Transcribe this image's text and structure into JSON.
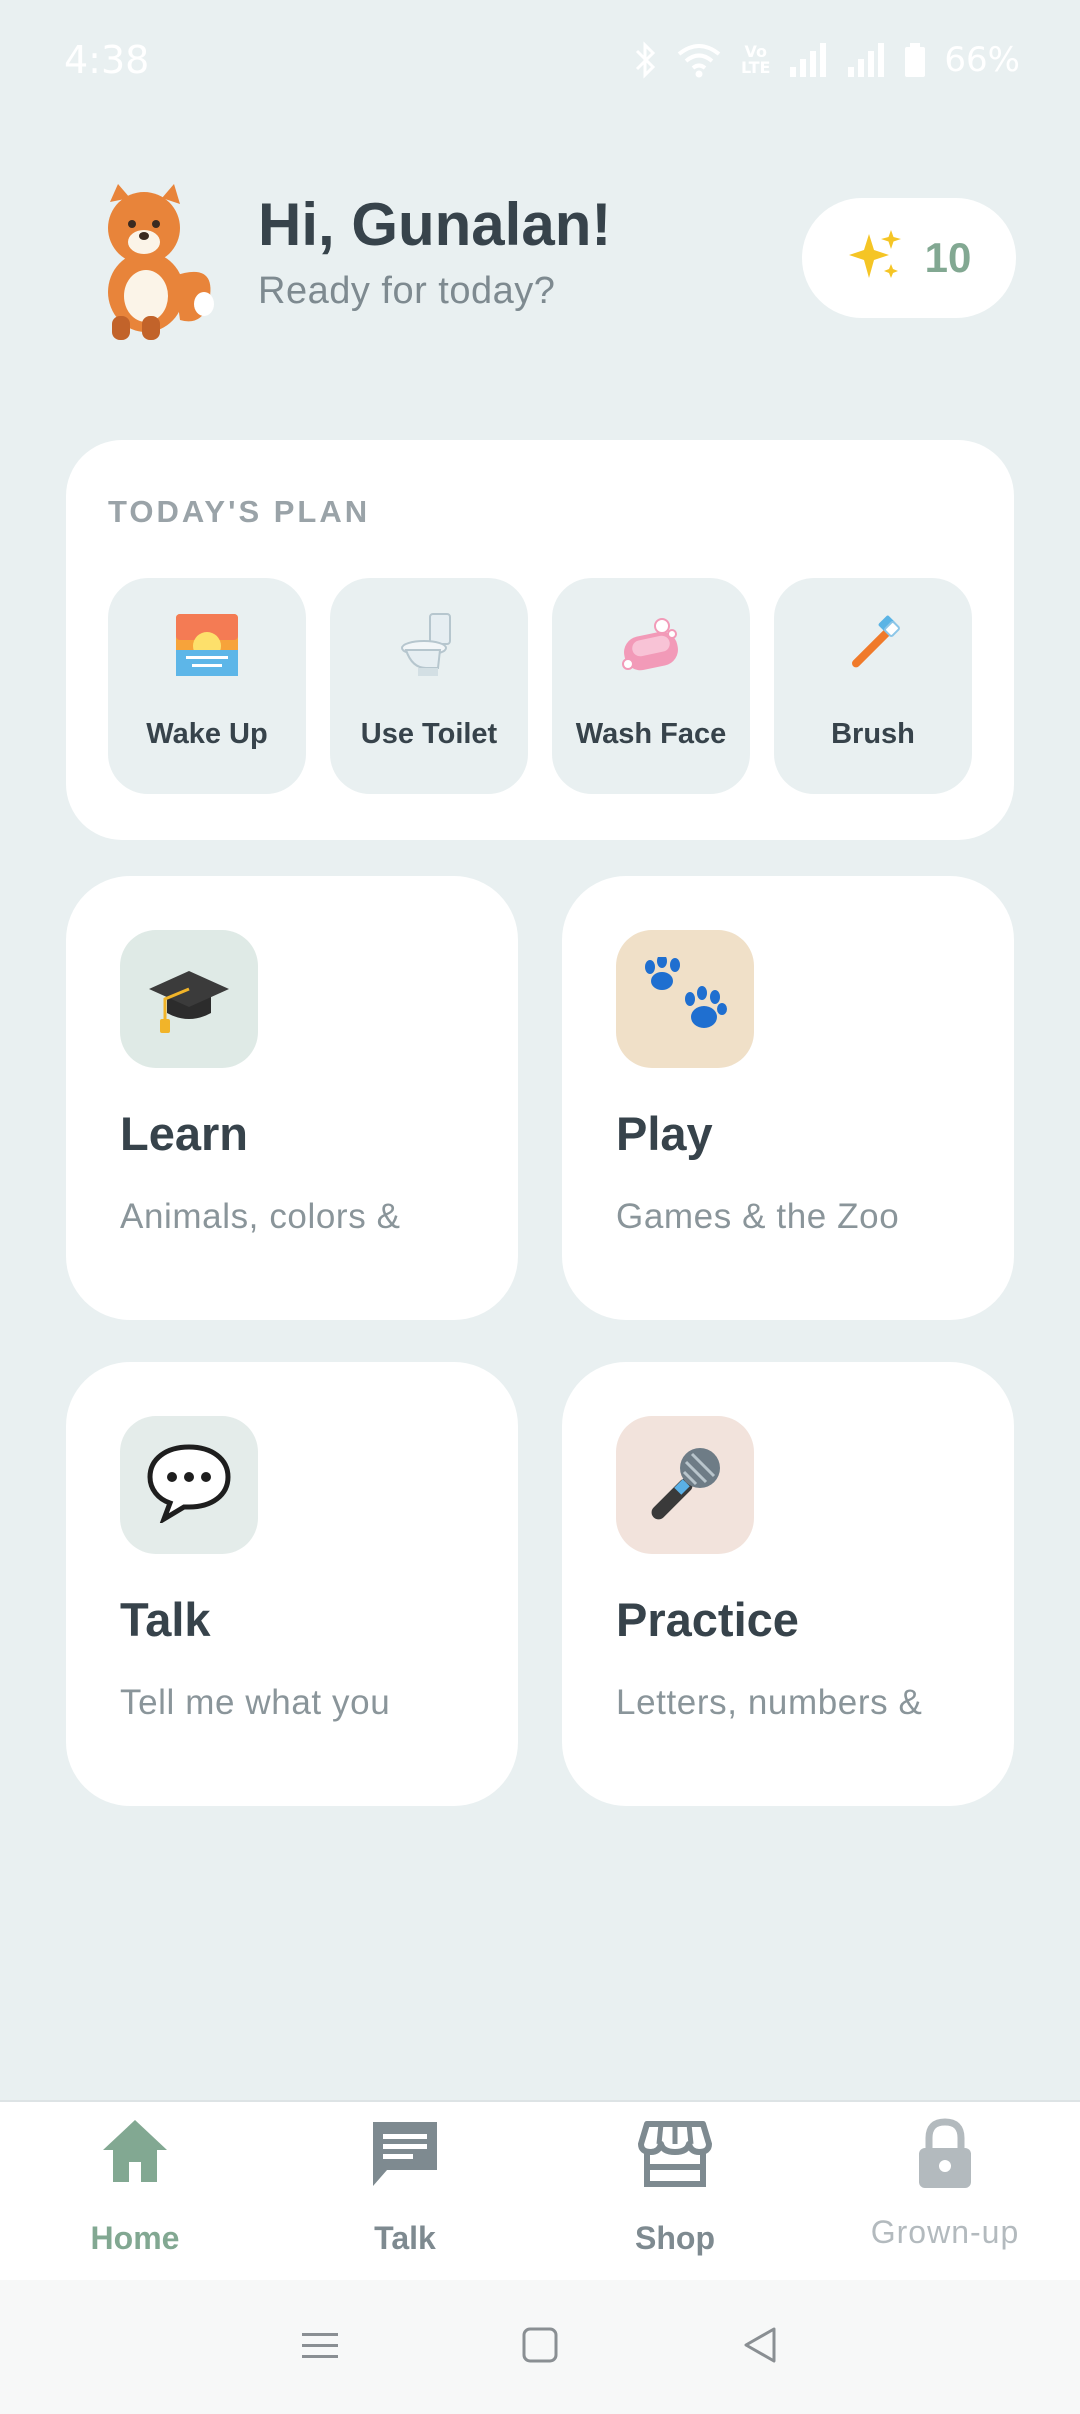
{
  "status_bar": {
    "time": "4:38",
    "battery": "66%",
    "network_badge_top": "Vo",
    "network_badge_bottom": "LTE"
  },
  "header": {
    "title": "Hi, Gunalan!",
    "subtitle": "Ready for today?",
    "stars_count": "10"
  },
  "plan": {
    "title": "TODAY'S PLAN",
    "items": [
      {
        "label": "Wake Up",
        "icon": "sunrise-icon"
      },
      {
        "label": "Use Toilet",
        "icon": "toilet-icon"
      },
      {
        "label": "Wash Face",
        "icon": "soap-icon"
      },
      {
        "label": "Brush",
        "icon": "toothbrush-icon"
      }
    ]
  },
  "cards": [
    {
      "title": "Learn",
      "subtitle": "Animals, colors &",
      "icon": "graduation-cap-icon",
      "icon_bg": "#dfeae6"
    },
    {
      "title": "Play",
      "subtitle": "Games & the Zoo",
      "icon": "paw-prints-icon",
      "icon_bg": "#f0e0c8"
    },
    {
      "title": "Talk",
      "subtitle": "Tell me what you",
      "icon": "speech-bubble-icon",
      "icon_bg": "#e4ecea"
    },
    {
      "title": "Practice",
      "subtitle": "Letters, numbers &",
      "icon": "microphone-icon",
      "icon_bg": "#f2e3dc"
    }
  ],
  "nav": {
    "items": [
      {
        "label": "Home",
        "icon": "home-icon",
        "active": true
      },
      {
        "label": "Talk",
        "icon": "chat-icon",
        "active": false
      },
      {
        "label": "Shop",
        "icon": "store-icon",
        "active": false
      },
      {
        "label": "Grown-up",
        "icon": "lock-icon",
        "active": false
      }
    ]
  },
  "colors": {
    "background": "#e9f0f1",
    "accent": "#82a892",
    "text_dark": "#37434b",
    "text_muted": "#8a959a"
  }
}
